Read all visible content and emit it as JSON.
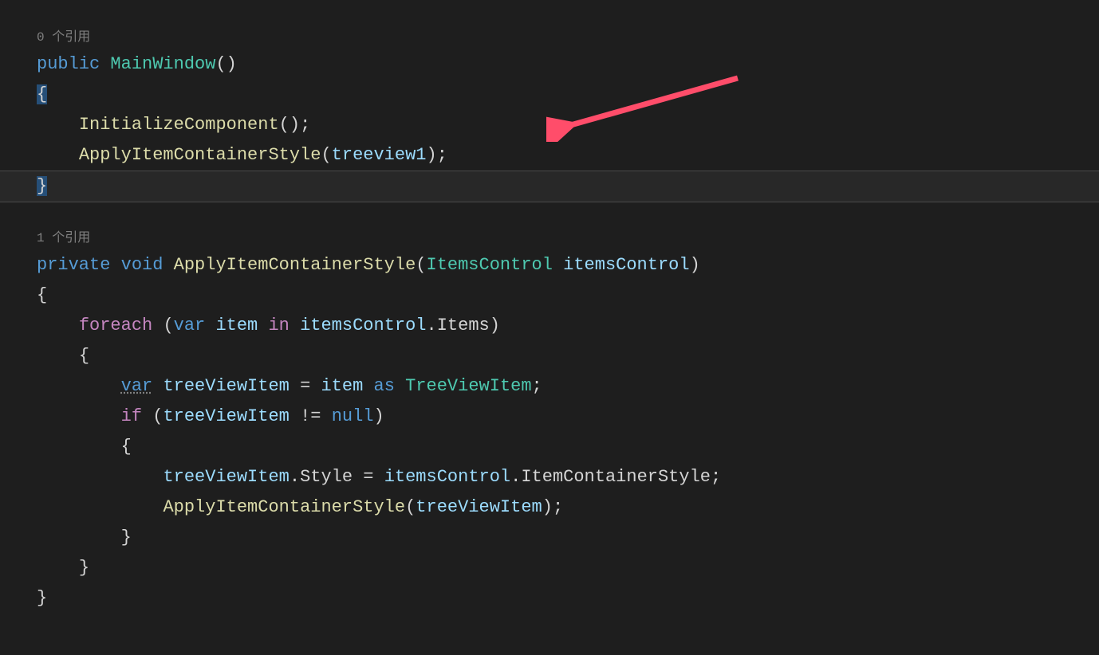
{
  "codelens": {
    "ref0": "0 个引用",
    "ref1": "1 个引用"
  },
  "tokens": {
    "public": "public",
    "private": "private",
    "void": "void",
    "foreach": "foreach",
    "var": "var",
    "in": "in",
    "as": "as",
    "if": "if",
    "null": "null",
    "MainWindow": "MainWindow",
    "InitializeComponent": "InitializeComponent",
    "ApplyItemContainerStyle": "ApplyItemContainerStyle",
    "treeview1": "treeview1",
    "ItemsControl": "ItemsControl",
    "itemsControl": "itemsControl",
    "item": "item",
    "Items": "Items",
    "treeViewItem": "treeViewItem",
    "TreeViewItem": "TreeViewItem",
    "Style": "Style",
    "ItemContainerStyle": "ItemContainerStyle"
  },
  "punct": {
    "parens": "()",
    "open_brace": "{",
    "close_brace": "}",
    "semi": ";",
    "lparen": "(",
    "rparen": ")",
    "dot": ".",
    "assign": " = ",
    "neq": " != ",
    "sp": " "
  },
  "arrow": {
    "color": "#ff4d6a"
  }
}
